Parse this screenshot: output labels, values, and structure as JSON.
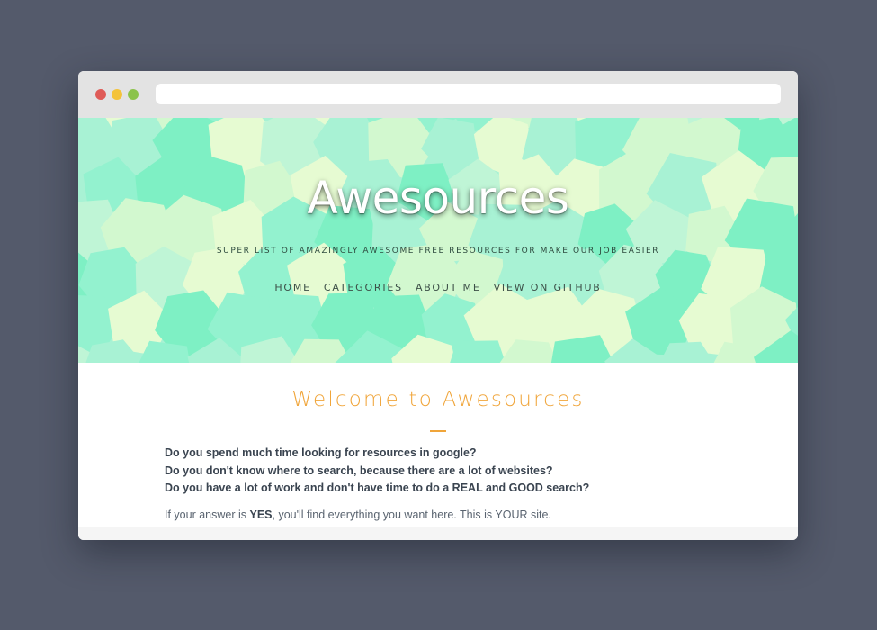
{
  "window": {
    "controls": [
      "close",
      "minimize",
      "maximize"
    ],
    "url": ""
  },
  "hero": {
    "title": "Awesources",
    "subtitle": "SUPER LIST OF AMAZINGLY AWESOME FREE RESOURCES FOR MAKE OUR JOB EASIER",
    "nav": [
      {
        "label": "HOME"
      },
      {
        "label": "CATEGORIES"
      },
      {
        "label": "ABOUT ME"
      },
      {
        "label": "VIEW ON GITHUB"
      }
    ]
  },
  "content": {
    "welcome": "Welcome to Awesources",
    "questions": [
      "Do you spend much time looking for resources in google?",
      "Do you don't know where to search, because there are a lot of websites?",
      "Do you have a lot of work and don't have time to do a REAL and GOOD search?"
    ],
    "answer_prefix": "If your answer is ",
    "answer_strong": "YES",
    "answer_suffix": ", you'll find everything you want here. This is YOUR site."
  },
  "colors": {
    "page_background": "#545a6b",
    "accent": "#f0a53a",
    "hero_palette": [
      "#7ef0c4",
      "#93f2cf",
      "#a8f2d4",
      "#bff5d6",
      "#d2f8cf",
      "#e6fbd2"
    ]
  }
}
